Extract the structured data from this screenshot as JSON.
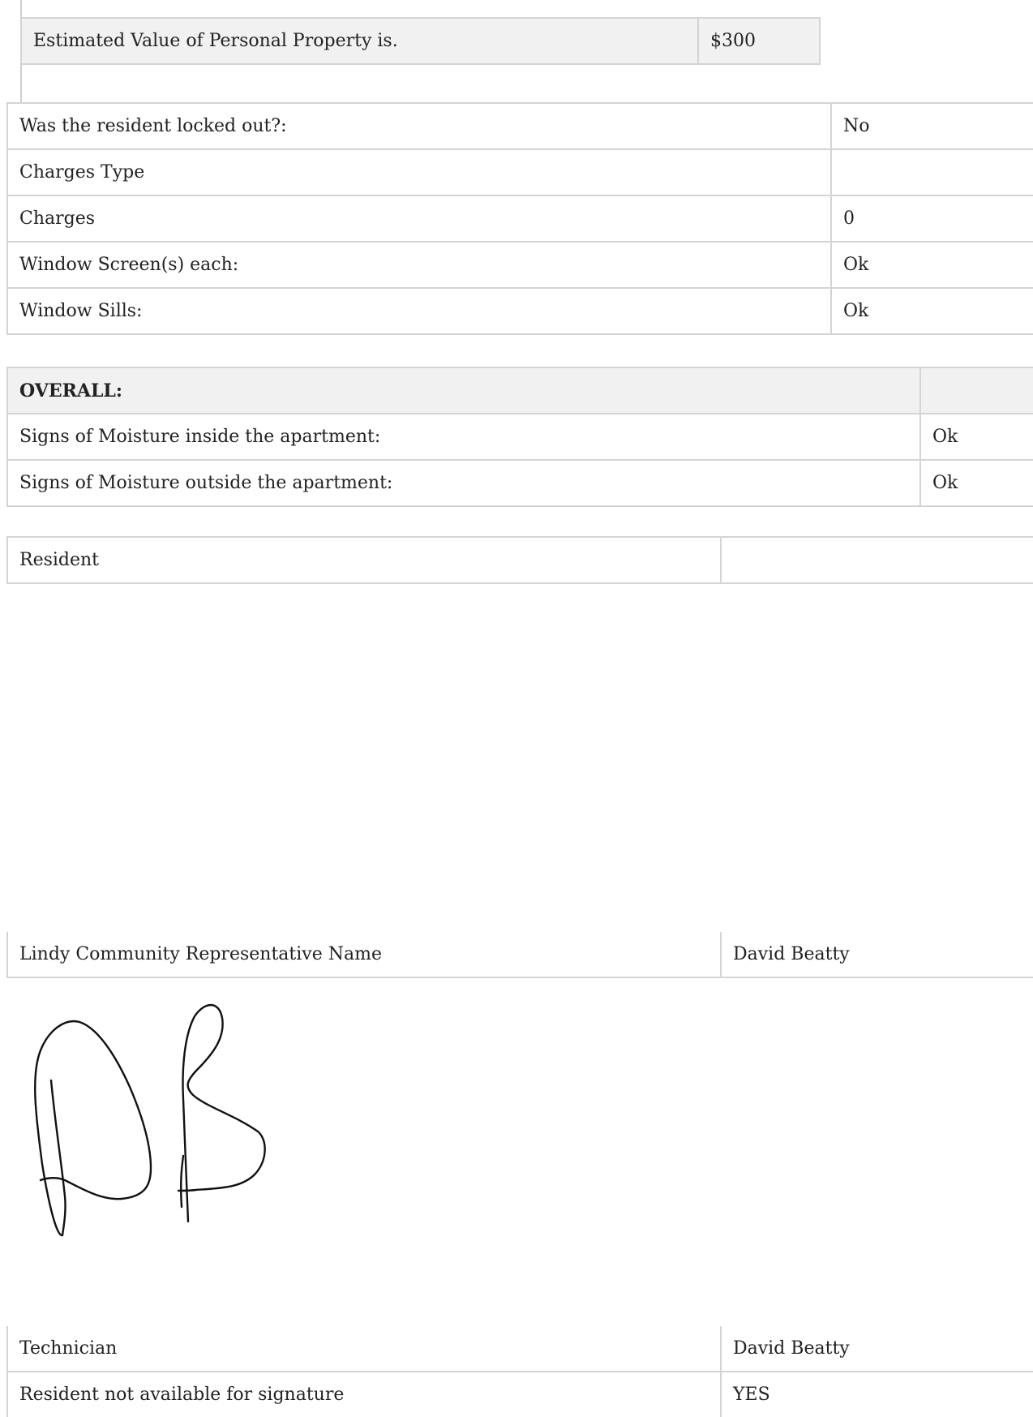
{
  "property_table": [
    {
      "label": "Estimated Value of Personal Property is.",
      "value": "$300"
    }
  ],
  "inspection_table": [
    {
      "label": "Was the resident locked out?:",
      "value": "No"
    },
    {
      "label": "Charges Type",
      "value": ""
    },
    {
      "label": "Charges",
      "value": "0"
    },
    {
      "label": "Window Screen(s) each:",
      "value": "Ok"
    },
    {
      "label": "Window Sills:",
      "value": "Ok"
    }
  ],
  "overall_table": {
    "header": "OVERALL:",
    "rows": [
      {
        "label": "Signs of Moisture inside the apartment:",
        "value": "Ok"
      },
      {
        "label": "Signs of Moisture outside the apartment:",
        "value": "Ok"
      }
    ]
  },
  "resident_table": {
    "label": "Resident",
    "value": ""
  },
  "representative_table": {
    "label": "Lindy Community Representative Name",
    "value": "David Beatty"
  },
  "signature": {
    "initials": "DB"
  },
  "technician_table": [
    {
      "label": "Technician",
      "value": "David Beatty"
    },
    {
      "label": "Resident not available for signature",
      "value": "YES"
    }
  ]
}
